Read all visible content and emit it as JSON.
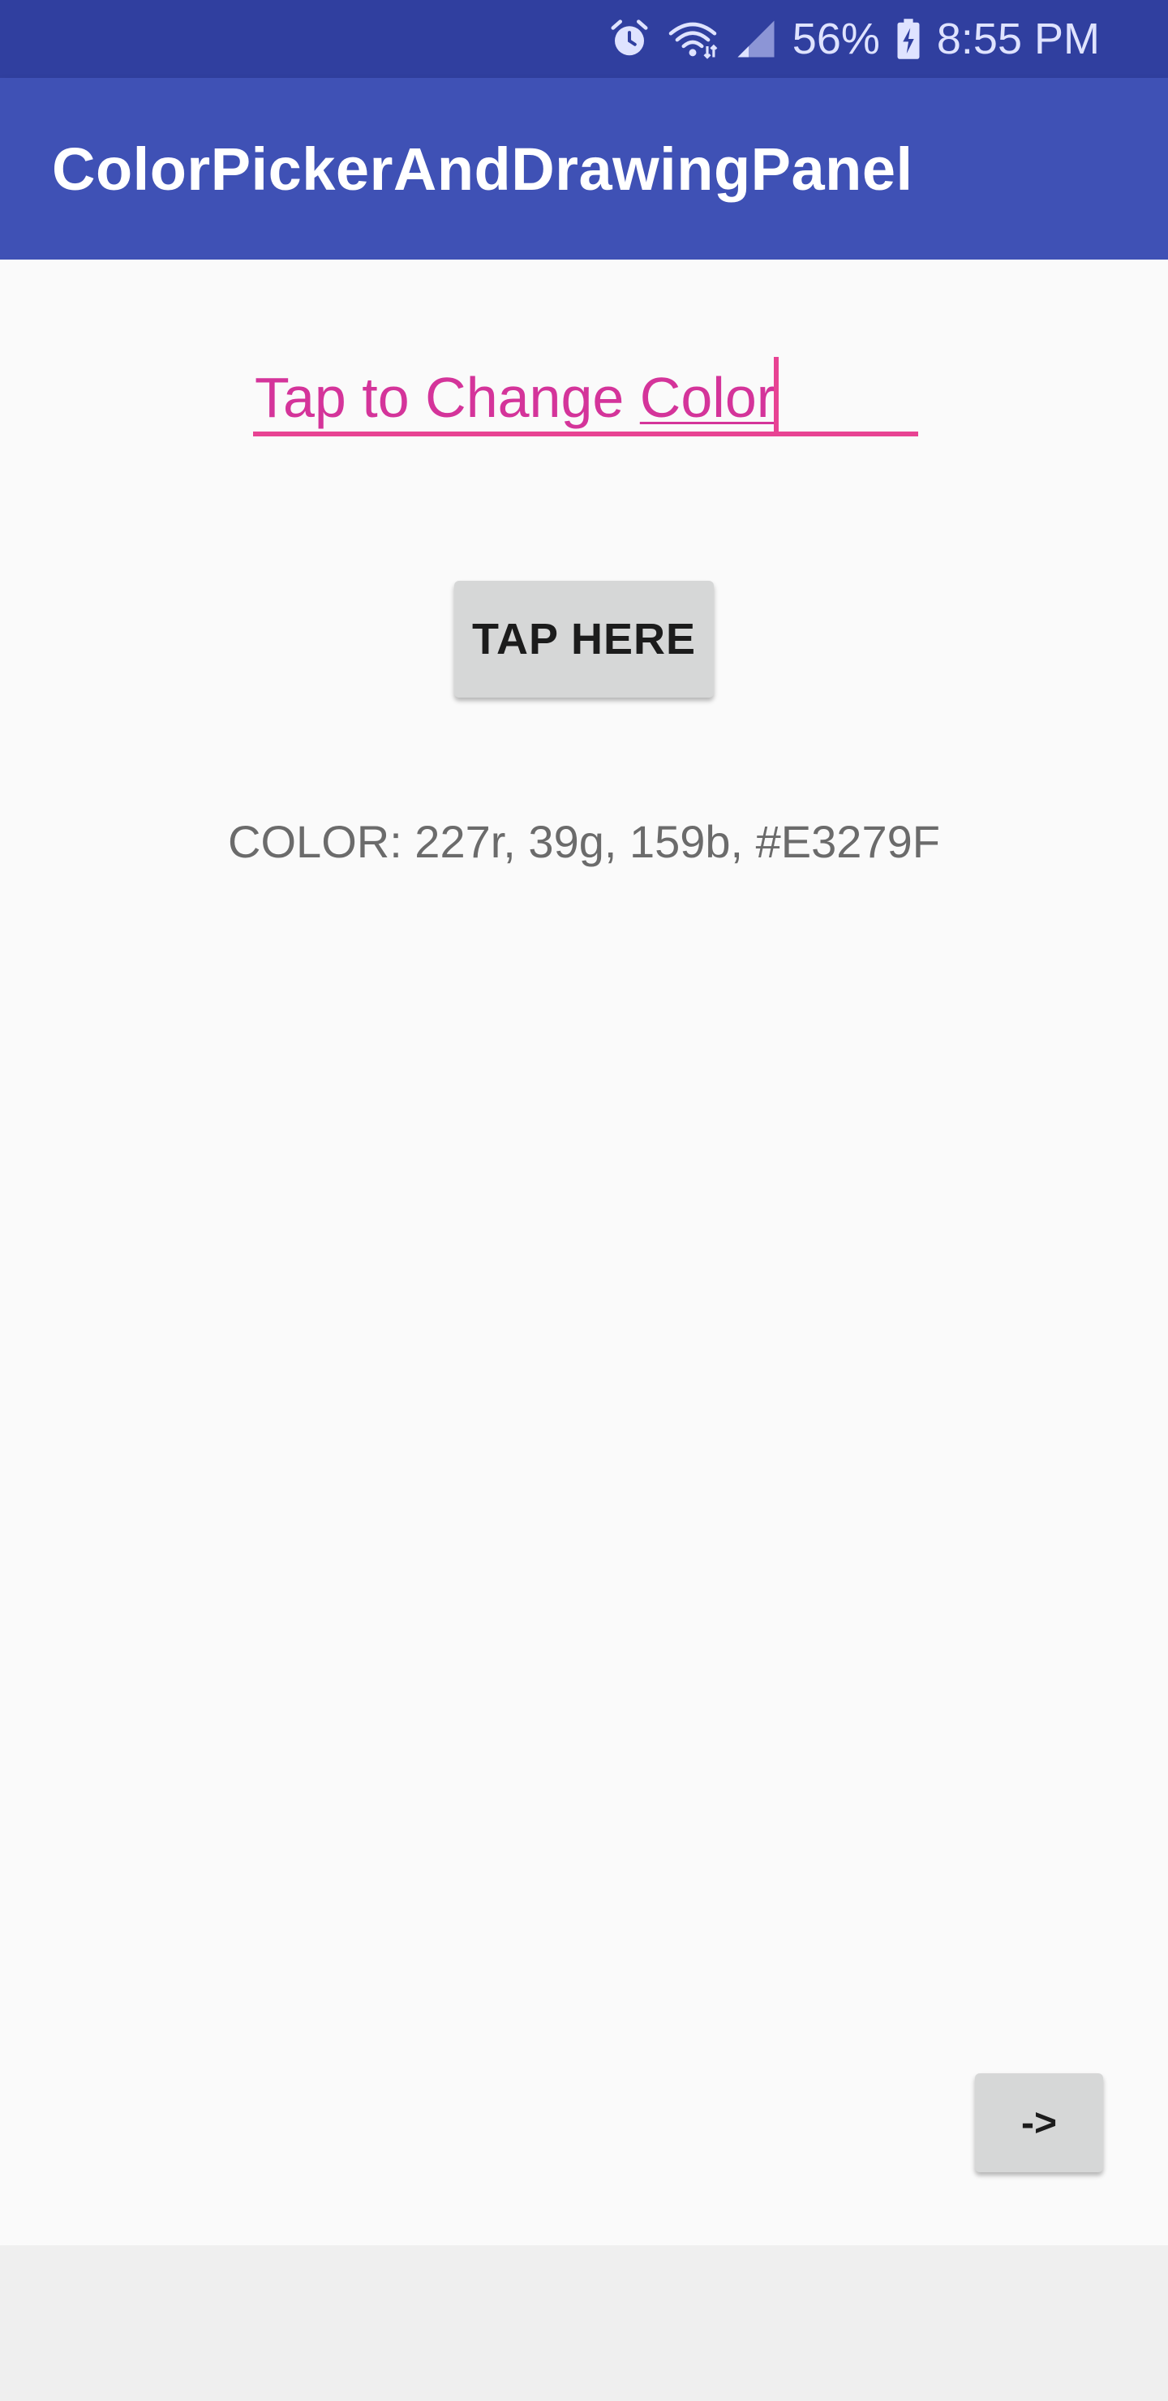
{
  "status_bar": {
    "icons": [
      "alarm-icon",
      "wifi-icon",
      "signal-icon",
      "battery-charging-icon"
    ],
    "battery_percent": "56%",
    "time": "8:55 PM",
    "background_color": "#303f9f"
  },
  "app_bar": {
    "title": "ColorPickerAndDrawingPanel",
    "background_color": "#3f51b5"
  },
  "main": {
    "text_field": {
      "value_prefix": "Tap to Change ",
      "value_suffix": "Color",
      "text_color": "#d4349a",
      "underline_color": "#e84393"
    },
    "tap_button_label": "TAP HERE",
    "color_readout": "COLOR: 227r, 39g, 159b, #E3279F",
    "next_button_label": "->"
  }
}
